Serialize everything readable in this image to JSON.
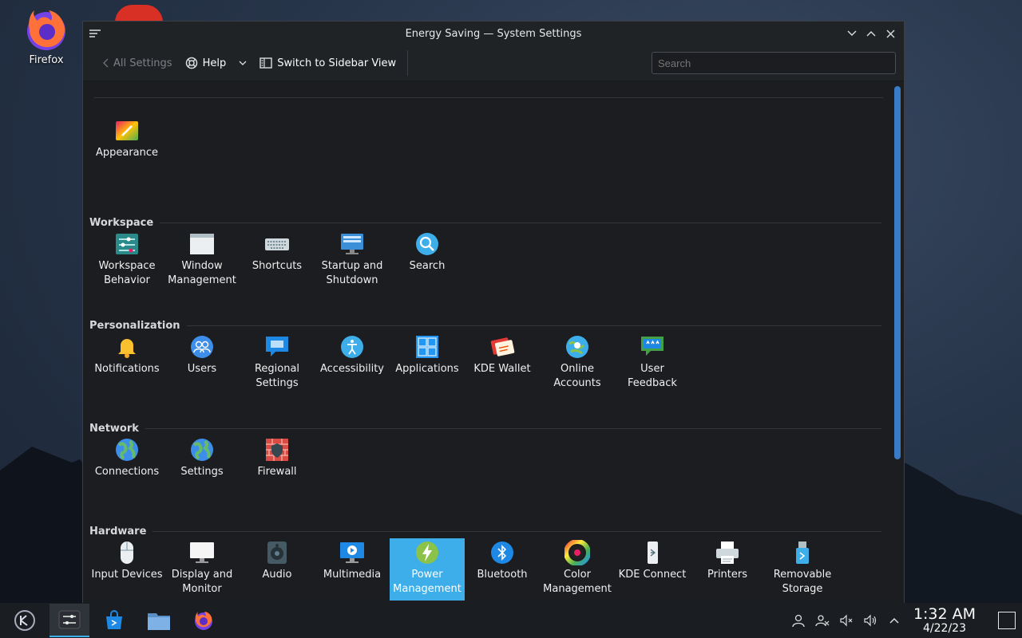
{
  "desktop": {
    "icons": [
      {
        "label": "Firefox",
        "icon": "firefox-icon"
      }
    ]
  },
  "window": {
    "title": "Energy Saving — System Settings",
    "toolbar": {
      "back_label": "All Settings",
      "help_label": "Help",
      "sidebar_label": "Switch to Sidebar View",
      "search_placeholder": "Search"
    }
  },
  "sections": [
    {
      "title": "",
      "items": [
        {
          "label": "Appearance",
          "icon": "appearance-icon"
        }
      ]
    },
    {
      "title": "Workspace",
      "items": [
        {
          "label": "Workspace Behavior",
          "icon": "workspace-behavior-icon"
        },
        {
          "label": "Window Management",
          "icon": "window-management-icon"
        },
        {
          "label": "Shortcuts",
          "icon": "keyboard-icon"
        },
        {
          "label": "Startup and Shutdown",
          "icon": "startup-icon"
        },
        {
          "label": "Search",
          "icon": "search-icon"
        }
      ]
    },
    {
      "title": "Personalization",
      "items": [
        {
          "label": "Notifications",
          "icon": "bell-icon"
        },
        {
          "label": "Users",
          "icon": "users-icon"
        },
        {
          "label": "Regional Settings",
          "icon": "regional-icon"
        },
        {
          "label": "Accessibility",
          "icon": "accessibility-icon"
        },
        {
          "label": "Applications",
          "icon": "applications-icon"
        },
        {
          "label": "KDE Wallet",
          "icon": "wallet-icon"
        },
        {
          "label": "Online Accounts",
          "icon": "online-accounts-icon"
        },
        {
          "label": "User Feedback",
          "icon": "feedback-icon"
        }
      ]
    },
    {
      "title": "Network",
      "items": [
        {
          "label": "Connections",
          "icon": "globe-icon"
        },
        {
          "label": "Settings",
          "icon": "globe-icon"
        },
        {
          "label": "Firewall",
          "icon": "firewall-icon"
        }
      ]
    },
    {
      "title": "Hardware",
      "items": [
        {
          "label": "Input Devices",
          "icon": "mouse-icon"
        },
        {
          "label": "Display and Monitor",
          "icon": "monitor-icon"
        },
        {
          "label": "Audio",
          "icon": "speaker-icon"
        },
        {
          "label": "Multimedia",
          "icon": "multimedia-icon"
        },
        {
          "label": "Power Management",
          "icon": "power-icon",
          "selected": true
        },
        {
          "label": "Bluetooth",
          "icon": "bluetooth-icon"
        },
        {
          "label": "Color Management",
          "icon": "color-icon"
        },
        {
          "label": "KDE Connect",
          "icon": "kdeconnect-icon"
        },
        {
          "label": "Printers",
          "icon": "printer-icon"
        },
        {
          "label": "Removable Storage",
          "icon": "usb-icon"
        }
      ]
    }
  ],
  "taskbar": {
    "clock_time": "1:32 AM",
    "clock_date": "4/22/23"
  },
  "colors": {
    "accent": "#3daee9",
    "window_bg": "#1b1d20"
  }
}
